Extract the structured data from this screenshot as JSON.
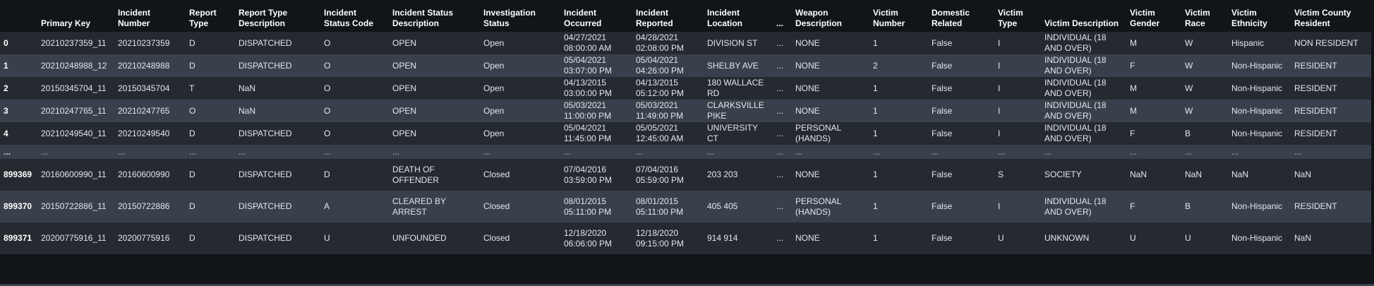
{
  "table": {
    "index_header": "",
    "columns": [
      "Primary Key",
      "Incident Number",
      "Report Type",
      "Report Type Description",
      "Incident Status Code",
      "Incident Status Description",
      "Investigation Status",
      "Incident Occurred",
      "Incident Reported",
      "Incident Location",
      "...",
      "Weapon Description",
      "Victim Number",
      "Domestic Related",
      "Victim Type",
      "Victim Description",
      "Victim Gender",
      "Victim Race",
      "Victim Ethnicity",
      "Victim County Resident"
    ],
    "rows": [
      {
        "index": "0",
        "cells": [
          "20210237359_11",
          "20210237359",
          "D",
          "DISPATCHED",
          "O",
          "OPEN",
          "Open",
          "04/27/2021 08:00:00 AM",
          "04/28/2021 02:08:00 PM",
          "DIVISION ST",
          "...",
          "NONE",
          "1",
          "False",
          "I",
          "INDIVIDUAL (18 AND OVER)",
          "M",
          "W",
          "Hispanic",
          "NON RESIDENT"
        ]
      },
      {
        "index": "1",
        "cells": [
          "20210248988_12",
          "20210248988",
          "D",
          "DISPATCHED",
          "O",
          "OPEN",
          "Open",
          "05/04/2021 03:07:00 PM",
          "05/04/2021 04:26:00 PM",
          "SHELBY AVE",
          "...",
          "NONE",
          "2",
          "False",
          "I",
          "INDIVIDUAL (18 AND OVER)",
          "F",
          "W",
          "Non-Hispanic",
          "RESIDENT"
        ]
      },
      {
        "index": "2",
        "cells": [
          "20150345704_11",
          "20150345704",
          "T",
          "NaN",
          "O",
          "OPEN",
          "Open",
          "04/13/2015 03:00:00 PM",
          "04/13/2015 05:12:00 PM",
          "180 WALLACE RD",
          "...",
          "NONE",
          "1",
          "False",
          "I",
          "INDIVIDUAL (18 AND OVER)",
          "M",
          "W",
          "Non-Hispanic",
          "RESIDENT"
        ]
      },
      {
        "index": "3",
        "cells": [
          "20210247765_11",
          "20210247765",
          "O",
          "NaN",
          "O",
          "OPEN",
          "Open",
          "05/03/2021 11:00:00 PM",
          "05/03/2021 11:49:00 PM",
          "CLARKSVILLE PIKE",
          "...",
          "NONE",
          "1",
          "False",
          "I",
          "INDIVIDUAL (18 AND OVER)",
          "M",
          "W",
          "Non-Hispanic",
          "RESIDENT"
        ]
      },
      {
        "index": "4",
        "cells": [
          "20210249540_11",
          "20210249540",
          "D",
          "DISPATCHED",
          "O",
          "OPEN",
          "Open",
          "05/04/2021 11:45:00 PM",
          "05/05/2021 12:45:00 AM",
          "UNIVERSITY CT",
          "...",
          "PERSONAL (HANDS)",
          "1",
          "False",
          "I",
          "INDIVIDUAL (18 AND OVER)",
          "F",
          "B",
          "Non-Hispanic",
          "RESIDENT"
        ]
      },
      {
        "index": "...",
        "cells": [
          "...",
          "...",
          "...",
          "...",
          "...",
          "...",
          "...",
          "...",
          "...",
          "...",
          "...",
          "...",
          "...",
          "...",
          "...",
          "...",
          "...",
          "...",
          "...",
          "..."
        ]
      },
      {
        "index": "899369",
        "cells": [
          "20160600990_11",
          "20160600990",
          "D",
          "DISPATCHED",
          "D",
          "DEATH OF OFFENDER",
          "Closed",
          "07/04/2016 03:59:00 PM",
          "07/04/2016 05:59:00 PM",
          "203 203",
          "...",
          "NONE",
          "1",
          "False",
          "S",
          "SOCIETY",
          "NaN",
          "NaN",
          "NaN",
          "NaN"
        ]
      },
      {
        "index": "899370",
        "cells": [
          "20150722886_11",
          "20150722886",
          "D",
          "DISPATCHED",
          "A",
          "CLEARED BY ARREST",
          "Closed",
          "08/01/2015 05:11:00 PM",
          "08/01/2015 05:11:00 PM",
          "405 405",
          "...",
          "PERSONAL (HANDS)",
          "1",
          "False",
          "I",
          "INDIVIDUAL (18 AND OVER)",
          "F",
          "B",
          "Non-Hispanic",
          "RESIDENT"
        ]
      },
      {
        "index": "899371",
        "cells": [
          "20200775916_11",
          "20200775916",
          "D",
          "DISPATCHED",
          "U",
          "UNFOUNDED",
          "Closed",
          "12/18/2020 06:06:00 PM",
          "12/18/2020 09:15:00 PM",
          "914 914",
          "...",
          "NONE",
          "1",
          "False",
          "U",
          "UNKNOWN",
          "U",
          "U",
          "Non-Hispanic",
          "NaN"
        ]
      }
    ]
  }
}
